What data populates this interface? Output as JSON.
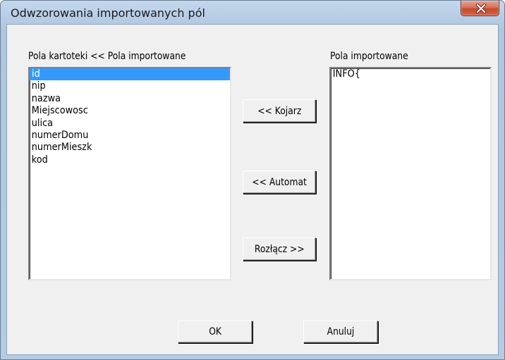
{
  "window": {
    "title": "Odwzorowania importowanych pól"
  },
  "left_panel": {
    "label": "Pola kartoteki << Pola importowane",
    "items": [
      "id",
      "nip",
      "nazwa",
      "Miejscowosc",
      "ulica",
      "numerDomu",
      "numerMieszk",
      "kod"
    ],
    "selected_item": "id"
  },
  "right_panel": {
    "label": "Pola importowane",
    "items": [
      "INFO{"
    ]
  },
  "buttons": {
    "kojarz": "<< Kojarz",
    "automat": "<< Automat",
    "rozlacz": "Rozłącz >>",
    "ok": "OK",
    "anuluj": "Anuluj"
  },
  "colors": {
    "selection": "#3399ff",
    "dialog_bg": "#f0f0f0",
    "close_button": "#c6492d"
  },
  "icons": {
    "close": "close-icon"
  }
}
